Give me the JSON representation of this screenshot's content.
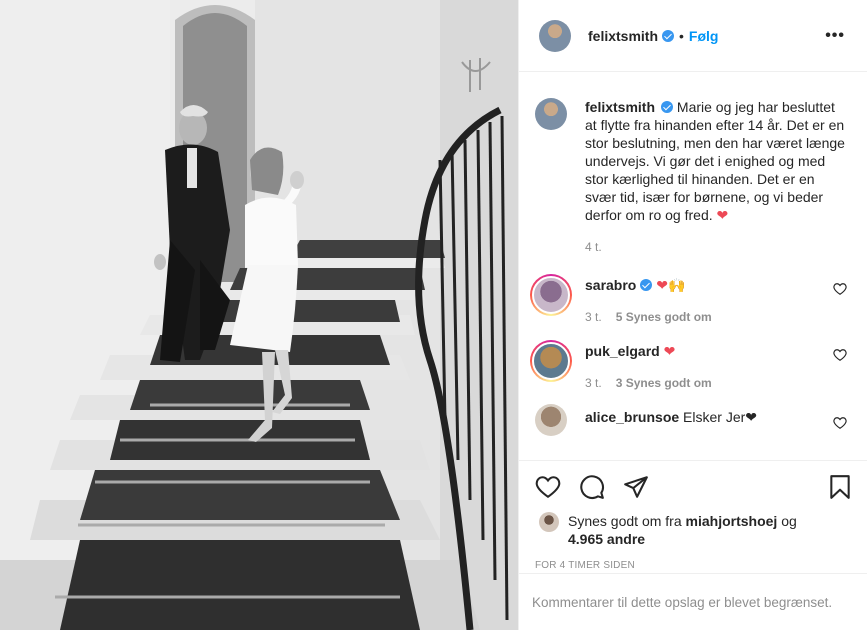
{
  "post": {
    "username": "felixtsmith",
    "follow_label": "Følg",
    "more_label": "•••",
    "caption": "Marie og jeg har besluttet at flytte fra hinanden efter 14 år. Det er en stor beslutning, men den har været længe undervejs. Vi gør det i enighed og med stor kærlighed til hinanden. Det er en svær tid, især for børnene, og vi beder derfor om ro og fred.",
    "caption_emoji": "❤",
    "caption_time": "4 t."
  },
  "comments": [
    {
      "username": "sarabro",
      "verified": true,
      "text": "❤🙌",
      "time": "3 t.",
      "likes": "5 Synes godt om"
    },
    {
      "username": "puk_elgard",
      "verified": false,
      "text": "❤",
      "time": "3 t.",
      "likes": "3 Synes godt om"
    },
    {
      "username": "alice_brunsoe",
      "verified": false,
      "text": "Elsker Jer❤",
      "time": "",
      "likes": ""
    }
  ],
  "likes": {
    "prefix": "Synes godt om fra",
    "user": "miahjortshoej",
    "conj": "og",
    "others": "4.965 andre"
  },
  "timestamp": "FOR 4 TIMER SIDEN",
  "comments_limited": "Kommentarer til dette opslag er blevet begrænset.",
  "colors": {
    "accent": "#0095f6",
    "verified": "#3897f0",
    "heart": "#ed4956",
    "muted": "#8e8e8e"
  },
  "icons": [
    "heart-icon",
    "comment-icon",
    "share-icon",
    "bookmark-icon",
    "verified-icon",
    "more-icon"
  ]
}
